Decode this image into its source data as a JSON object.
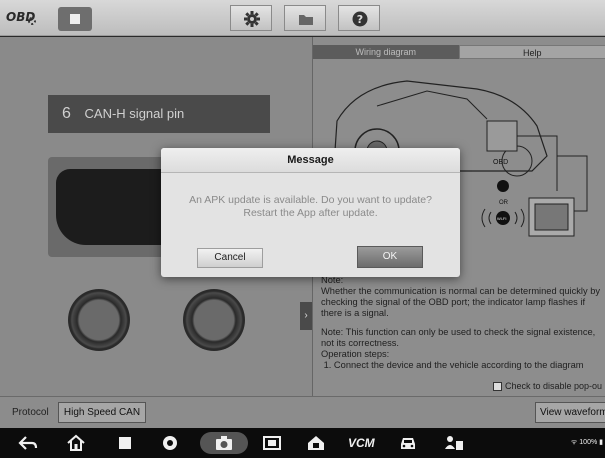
{
  "toolbar": {
    "app_logo": "OBD",
    "stop_icon": "stop-icon",
    "settings_icon": "gear-icon",
    "folder_icon": "folder-icon",
    "help_icon": "help-icon"
  },
  "left_panel": {
    "pin_number": "6",
    "pin_label": "CAN-H signal pin"
  },
  "right_panel": {
    "tabs": [
      {
        "label": "Wiring diagram",
        "active": true
      },
      {
        "label": "Help",
        "active": false
      }
    ],
    "diagram_labels": {
      "obd": "OBD",
      "or": "OR",
      "wifi": "Wi-Fi"
    },
    "notes": {
      "note_heading": "Note:",
      "note_body": "Whether the communication is normal can be determined quickly by checking the signal of the OBD port; the indicator lamp flashes if there is a signal.",
      "note2": "Note: This function can only be used to check the signal existence, not its correctness.",
      "steps_heading": "Operation steps:",
      "step1": "1. Connect the device and the vehicle according to the diagram"
    },
    "checkbox_label": "Check to disable pop-ou"
  },
  "protocol": {
    "label": "Protocol",
    "value": "High Speed CAN",
    "view_waveform": "View waveform"
  },
  "dialog": {
    "title": "Message",
    "message_line1": "An APK update is available. Do you want to update?",
    "message_line2": "Restart the App after update.",
    "cancel": "Cancel",
    "ok": "OK"
  },
  "navbar": {
    "items": [
      "back-icon",
      "home-icon",
      "recent-apps-icon",
      "chrome-icon",
      "camera-icon",
      "screenshot-icon",
      "vci-home-icon",
      "vcm-icon",
      "car-icon",
      "user-device-icon"
    ],
    "vcm_label": "VCM",
    "status": "100%"
  }
}
